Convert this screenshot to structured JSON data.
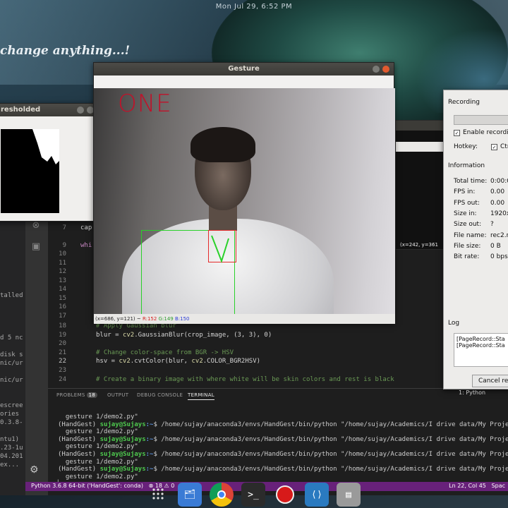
{
  "desktop": {
    "clock": "Mon Jul 29,  6:52 PM",
    "quote": "change anything...!"
  },
  "threshold_window": {
    "title": "resholded"
  },
  "gesture_window": {
    "title": "Gesture",
    "overlay_text": "ONE",
    "status_coords": "(x=686, y=121) ~ ",
    "status_r": "R:152",
    "status_g": "G:149",
    "status_b": "B:150"
  },
  "dark_window_status": "(x=242, y=361",
  "recording_window": {
    "recording_label": "Recording",
    "enable_label": "Enable recordi",
    "hotkey_label": "Hotkey:",
    "hotkey_value": "Ctr",
    "information_label": "Information",
    "info": [
      {
        "key": "Total time:",
        "value": "0:00:0"
      },
      {
        "key": "FPS in:",
        "value": "0.00"
      },
      {
        "key": "FPS out:",
        "value": "0.00"
      },
      {
        "key": "Size in:",
        "value": "1920x"
      },
      {
        "key": "Size out:",
        "value": "?"
      },
      {
        "key": "File name:",
        "value": "rec2.r"
      },
      {
        "key": "File size:",
        "value": "0 B"
      },
      {
        "key": "Bit rate:",
        "value": "0 bps"
      }
    ],
    "log_label": "Log",
    "log_lines": [
      "[PageRecord::Sta",
      "[PageRecord::Sta"
    ],
    "cancel_label": "Cancel re",
    "python_tab": "1: Python"
  },
  "vscode": {
    "sidebar_texts": [
      "talled",
      "d 5 nc",
      "disk s",
      "nic/ur",
      "nic/ur",
      "escree",
      "ories",
      "0.3.8-",
      "ntu1)",
      ".23-1u",
      "04.201",
      "ex..."
    ],
    "line_numbers": [
      "7",
      "9",
      "10",
      "11",
      "12",
      "13",
      "14",
      "15",
      "16",
      "17",
      "18",
      "19",
      "20",
      "21",
      "22",
      "23",
      "24"
    ],
    "code": {
      "l7": "cap",
      "l9": "whi",
      "l18": "# Apply Gaussian blur",
      "l19_a": "blur = ",
      "l19_b": "cv2",
      "l19_c": ".GaussianBlur(crop_image, (3, 3), 0)",
      "l21": "# Change color-space from BGR -> HSV",
      "l22_a": "hsv = ",
      "l22_b": "cv2",
      "l22_c": ".cvtColor(blur, ",
      "l22_d": "cv2",
      "l22_e": ".COLOR_BGR2HSV)",
      "l24": "# Create a binary image with where white will be skin colors and rest is black"
    },
    "panel_tabs": [
      "PROBLEMS",
      "OUTPUT",
      "DEBUG CONSOLE",
      "TERMINAL"
    ],
    "problems_count": "18",
    "terminal_lines": [
      {
        "kind": "plain",
        "text": "  gesture 1/demo2.py\""
      },
      {
        "kind": "prompt",
        "env": "(HandGest) ",
        "user": "sujay@Sujays",
        "path": ":~",
        "cmd": "$ /home/sujay/anaconda3/envs/HandGest/bin/python \"/home/sujay/Academics/I drive data/My Project"
      },
      {
        "kind": "plain",
        "text": "  gesture 1/demo2.py\""
      },
      {
        "kind": "prompt",
        "env": "(HandGest) ",
        "user": "sujay@Sujays",
        "path": ":~",
        "cmd": "$ /home/sujay/anaconda3/envs/HandGest/bin/python \"/home/sujay/Academics/I drive data/My Project"
      },
      {
        "kind": "plain",
        "text": "  gesture 1/demo2.py\""
      },
      {
        "kind": "prompt",
        "env": "(HandGest) ",
        "user": "sujay@Sujays",
        "path": ":~",
        "cmd": "$ /home/sujay/anaconda3/envs/HandGest/bin/python \"/home/sujay/Academics/I drive data/My Project"
      },
      {
        "kind": "plain",
        "text": "  gesture 1/demo2.py\""
      },
      {
        "kind": "prompt",
        "env": "(HandGest) ",
        "user": "sujay@Sujays",
        "path": ":~",
        "cmd": "$ /home/sujay/anaconda3/envs/HandGest/bin/python \"/home/sujay/Academics/I drive data/My Project"
      },
      {
        "kind": "plain",
        "text": "  gesture 1/demo2.py\""
      },
      {
        "kind": "plain",
        "text": "▏"
      }
    ],
    "status_python": "Python 3.6.8 64-bit ('HandGest': conda)",
    "status_errors": "⊗ 18 ⚠ 0",
    "status_position": "Ln 22, Col 45",
    "status_spaces": "Spac"
  },
  "dock_items": [
    {
      "name": "files",
      "color": "#3a7bd5"
    },
    {
      "name": "chrome",
      "color": "#e8e8e8"
    },
    {
      "name": "terminal",
      "color": "#2b2b2b"
    },
    {
      "name": "record",
      "color": "#d71a1a"
    },
    {
      "name": "vscode",
      "color": "#2a7ac0"
    },
    {
      "name": "storage",
      "color": "#9a9a9a"
    }
  ]
}
